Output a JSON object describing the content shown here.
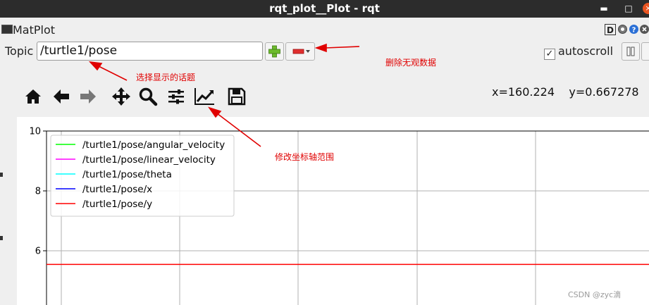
{
  "window": {
    "title": "rqt_plot__Plot - rqt",
    "minimize_glyph": "▬",
    "maximize_glyph": "□",
    "close_glyph": "×"
  },
  "dock": {
    "title": "MatPlot",
    "d_button": "D",
    "extra_glyph": "-"
  },
  "topic_bar": {
    "label": "Topic",
    "input_value": "/turtle1/pose",
    "autoscroll_label": "autoscroll",
    "autoscroll_checked": true,
    "check_glyph": "✓"
  },
  "toolbar": {
    "icons": [
      "home-icon",
      "back-arrow-icon",
      "forward-arrow-icon",
      "pan-icon",
      "zoom-icon",
      "configure-subplots-icon",
      "edit-axis-icon",
      "save-icon"
    ]
  },
  "coords": {
    "x_label": "x=160.224",
    "y_label": "y=0.667278"
  },
  "chart_data": {
    "type": "line",
    "ylim": [
      4,
      10
    ],
    "yticks": [
      "10",
      "8",
      "6"
    ],
    "grid": true,
    "legend_location": "upper-left",
    "series": [
      {
        "name": "/turtle1/pose/angular_velocity",
        "color": "#00ff00"
      },
      {
        "name": "/turtle1/pose/linear_velocity",
        "color": "#ff00ff"
      },
      {
        "name": "/turtle1/pose/theta",
        "color": "#00ffff"
      },
      {
        "name": "/turtle1/pose/x",
        "color": "#0000ff"
      },
      {
        "name": "/turtle1/pose/y",
        "color": "#ff0000",
        "constant_value": 5.544
      }
    ]
  },
  "annotations": {
    "topic_note": "选择显示的话题",
    "remove_note": "删除无观数据",
    "axis_note": "修改坐标轴范围",
    "color": "#e00000"
  },
  "watermark": "CSDN @zyc滴"
}
